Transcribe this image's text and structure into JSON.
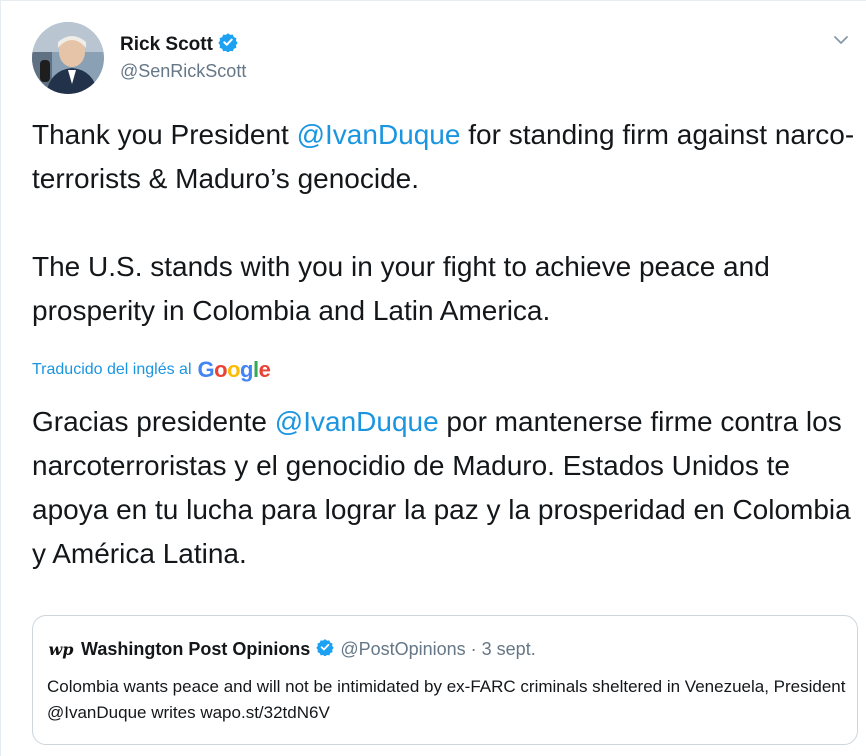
{
  "tweet": {
    "author_name": "Rick Scott",
    "author_handle": "@SenRickScott",
    "text_p1_a": "Thank you President ",
    "text_p1_mention": "@IvanDuque",
    "text_p1_b": " for standing firm against narco-terrorists & Maduro’s genocide.",
    "text_p2": "The U.S. stands with you in your fight to achieve peace and prosperity in Colombia and Latin America.",
    "translated_label": "Traducido del inglés al",
    "translation_engine": "Google",
    "translation_a": "Gracias presidente ",
    "translation_mention": "@IvanDuque",
    "translation_b": " por mantenerse firme contra los narcoterroristas y el genocidio de Maduro. Estados Unidos te apoya en tu lucha para lograr la paz y la prosperidad en Colombia y América Latina."
  },
  "quoted": {
    "logo_text": "wp",
    "name": "Washington Post Opinions",
    "handle_date": "@PostOpinions · 3 sept.",
    "text": "Colombia wants peace and will not be intimidated by ex-FARC criminals sheltered in Venezuela, President @IvanDuque writes wapo.st/32tdN6V"
  },
  "colors": {
    "link": "#1b95e0",
    "verified": "#1da1f2",
    "secondary_text": "#657786"
  },
  "icons": {
    "verified": "verified-badge-icon",
    "caret": "chevron-down-icon"
  }
}
